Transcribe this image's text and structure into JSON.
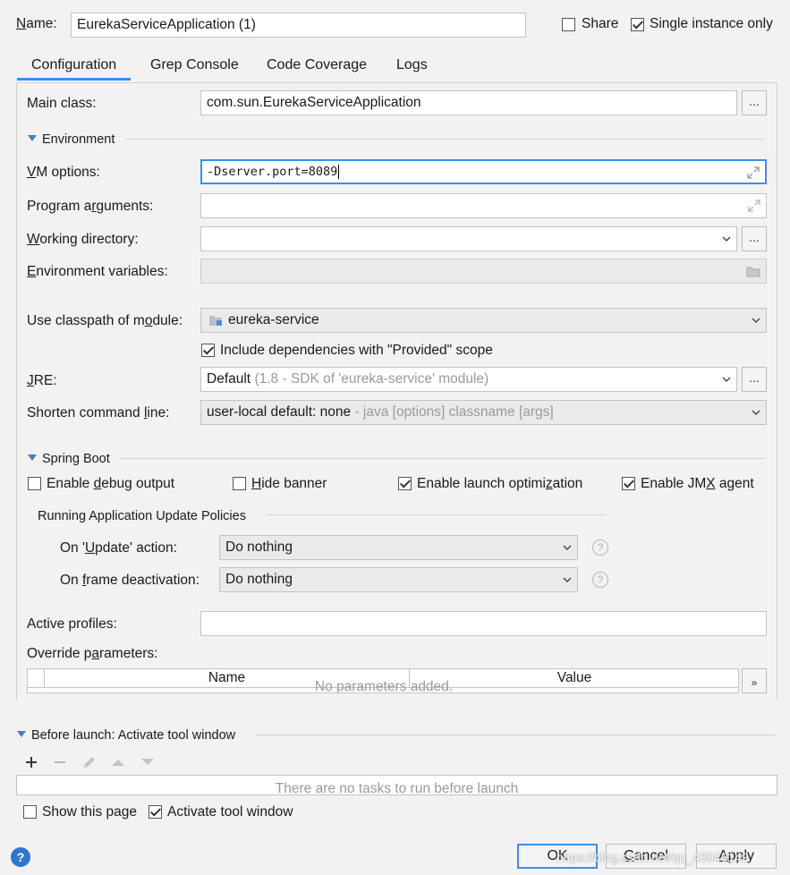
{
  "header": {
    "name_label": "Name:",
    "name_value": "EurekaServiceApplication (1)",
    "share_label": "Share",
    "share_checked": false,
    "single_instance_label": "Single instance only",
    "single_instance_checked": true
  },
  "tabs": [
    {
      "label": "Configuration",
      "active": true
    },
    {
      "label": "Grep Console",
      "active": false
    },
    {
      "label": "Code Coverage",
      "active": false
    },
    {
      "label": "Logs",
      "active": false
    }
  ],
  "config": {
    "main_class_label": "Main class:",
    "main_class_value": "com.sun.EurekaServiceApplication",
    "environment_section": "Environment",
    "vm_options_label": "VM options:",
    "vm_options_value": "-Dserver.port=8089",
    "program_args_label": "Program arguments:",
    "program_args_value": "",
    "working_dir_label": "Working directory:",
    "working_dir_value": "",
    "env_vars_label": "Environment variables:",
    "env_vars_value": "",
    "classpath_label": "Use classpath of module:",
    "classpath_value": "eureka-service",
    "include_deps_label": "Include dependencies with \"Provided\" scope",
    "include_deps_checked": true,
    "jre_label": "JRE:",
    "jre_value": "Default",
    "jre_detail": "(1.8 - SDK of 'eureka-service' module)",
    "shorten_label": "Shorten command line:",
    "shorten_value": "user-local default: none",
    "shorten_detail": "- java [options] classname [args]",
    "dots_button": "..."
  },
  "spring_boot": {
    "section": "Spring Boot",
    "debug_output_label": "Enable debug output",
    "debug_output_checked": false,
    "hide_banner_label": "Hide banner",
    "hide_banner_checked": false,
    "launch_opt_label": "Enable launch optimization",
    "launch_opt_checked": true,
    "jmx_label": "Enable JMX agent",
    "jmx_checked": true,
    "policies_section": "Running Application Update Policies",
    "on_update_label": "On 'Update' action:",
    "on_update_value": "Do nothing",
    "on_frame_label": "On frame deactivation:",
    "on_frame_value": "Do nothing",
    "help_glyph": "?",
    "active_profiles_label": "Active profiles:",
    "active_profiles_value": "",
    "override_label": "Override parameters:",
    "table_headers": [
      "Name",
      "Value"
    ],
    "table_empty": "No parameters added.",
    "expand_glyph": "»"
  },
  "before_launch": {
    "section": "Before launch: Activate tool window",
    "empty_text": "There are no tasks to run before launch",
    "show_page_label": "Show this page",
    "show_page_checked": false,
    "activate_tool_label": "Activate tool window",
    "activate_tool_checked": true
  },
  "footer": {
    "help_glyph": "?",
    "ok_label": "OK",
    "cancel_label": "Cancel",
    "apply_label": "Apply",
    "watermark": "https://blog.csdn.net/qq_43046149"
  },
  "colors": {
    "accent": "#3d8ee8",
    "background": "#f2f2f2",
    "help_blue": "#2e77d0"
  }
}
